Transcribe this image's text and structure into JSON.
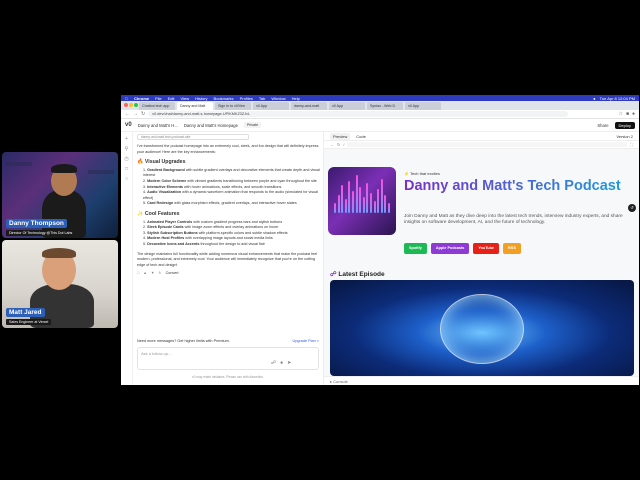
{
  "macos_menu": {
    "items": [
      "Chrome",
      "File",
      "Edit",
      "View",
      "History",
      "Bookmarks",
      "Profiles",
      "Tab",
      "Window",
      "Help"
    ],
    "clock": "Tue Apr 8  12:04 PM"
  },
  "browser": {
    "tabs": [
      "Chatbot tech app",
      "Danny and Matt",
      "Sign in to v0/Ven",
      "v0 App",
      "danny-and-matt",
      "v0 App",
      "Syntax - Web D",
      "v0 App"
    ],
    "url": "v0.dev/chat/danny-and-matt-s-homepage-UPIKMKZ3ZJvL"
  },
  "app_header": {
    "project": "Danny and Matt's H...",
    "chat_title": "Danny and Matt's Homepage",
    "visibility": "Private",
    "share_label": "Share",
    "deploy_label": "Deploy"
  },
  "chat": {
    "version_chip": "danny-and-matt-tech-podcast-site",
    "intro": "I've transformed the podcast homepage into an extremely cool, sleek, and fun design that will definitely impress your audience! Here are the key enhancements:",
    "section1": "🔥 Visual Upgrades",
    "items1": [
      {
        "n": "1.",
        "title": "Gradient Background",
        "text": "with subtle gradient overlays and decorative elements that create depth and visual interest"
      },
      {
        "n": "2.",
        "title": "Modern Color Scheme",
        "text": "with vibrant gradients transitioning between purple and cyan throughout the site"
      },
      {
        "n": "3.",
        "title": "Interactive Elements",
        "text": "with hover animations, scale effects, and smooth transitions"
      },
      {
        "n": "4.",
        "title": "Audio Visualization",
        "text": "with a dynamic waveform animation that responds to the audio (simulated for visual effect)"
      },
      {
        "n": "5.",
        "title": "Card Redesign",
        "text": "with glass morphism effects, gradient overlays, and interactive hover states"
      }
    ],
    "section2": "✨ Cool Features",
    "items2": [
      {
        "n": "1.",
        "title": "Animated Player Controls",
        "text": "with custom gradient progress bars and stylish buttons"
      },
      {
        "n": "2.",
        "title": "Sleek Episode Cards",
        "text": "with image zoom effects and overlay animations on hover"
      },
      {
        "n": "3.",
        "title": "Stylish Subscription Buttons",
        "text": "with platform-specific colors and subtle shadow effects"
      },
      {
        "n": "4.",
        "title": "Modern Host Profiles",
        "text": "with overlapping image layouts and social media links"
      },
      {
        "n": "5.",
        "title": "Decorative Icons and Accents",
        "text": "throughout the design to add visual flair"
      }
    ],
    "outro": "The design maintains full functionality while adding numerous visual enhancements that make the podcast feel modern, professional, and extremely cool. Your audience will immediately recognize that you're on the cutting edge of tech and design!",
    "actions_label": "Convert",
    "upsell_text": "Need more messages? Get higher limits with Premium.",
    "upgrade_label": "Upgrade Plan ×",
    "input_placeholder": "Ask a follow-up...",
    "footer": "v0 may make mistakes. Please use with discretion."
  },
  "preview": {
    "tab_preview": "Preview",
    "tab_code": "Code",
    "version": "Version 2",
    "tagline": "Tech that excites",
    "title": "Danny and Matt's Tech Podcast",
    "description": "Join Danny and Matt as they dive deep into the latest tech trends, interview industry experts, and share insights on software development, AI, and the future of technology.",
    "platforms": [
      {
        "label": "Spotify",
        "color": "#1db954"
      },
      {
        "label": "Apple Podcasts",
        "color": "#8e3bd6"
      },
      {
        "label": "YouTube",
        "color": "#e62117"
      },
      {
        "label": "RSS",
        "color": "#f2a023"
      }
    ],
    "latest_heading": "Latest Episode",
    "console_label": "Console"
  },
  "participants": [
    {
      "name": "Danny Thompson",
      "role": "Director Of Technology @This Dot Labs"
    },
    {
      "name": "Matt Jared",
      "role": "Sales Engineer at Vercel"
    }
  ],
  "colors": {
    "accent": "#2b5fb8",
    "title_gradient_start": "#7a2fc9",
    "title_gradient_end": "#1aa0d8"
  }
}
